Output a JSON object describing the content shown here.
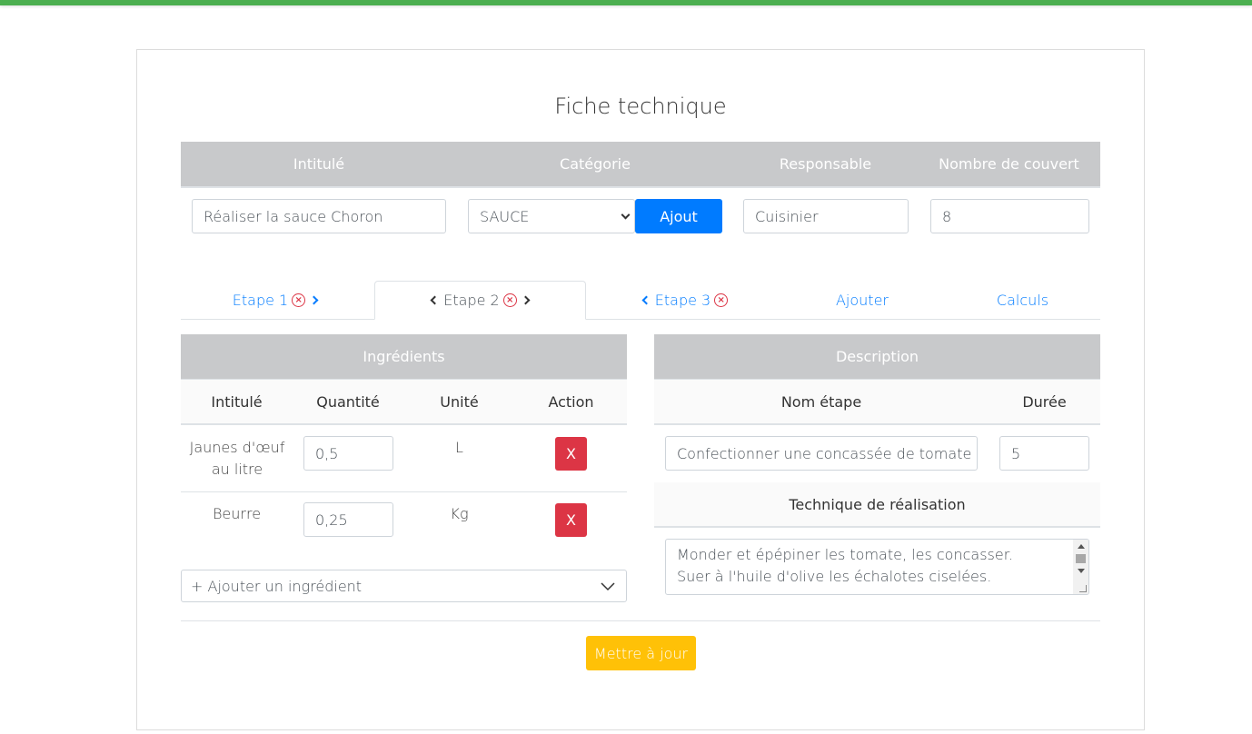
{
  "page": {
    "title": "Fiche technique"
  },
  "general": {
    "headers": {
      "intitule": "Intitulé",
      "categorie": "Catégorie",
      "responsable": "Responsable",
      "couverts": "Nombre de couvert"
    },
    "intitule_value": "Réaliser la sauce Choron",
    "categorie_value": "SAUCE",
    "ajout_label": "Ajout",
    "responsable_value": "Cuisinier",
    "couverts_value": "8"
  },
  "tabs": [
    {
      "label": "Etape 1"
    },
    {
      "label": "Etape 2"
    },
    {
      "label": "Etape 3"
    },
    {
      "label": "Ajouter"
    },
    {
      "label": "Calculs"
    }
  ],
  "ingredients": {
    "title": "Ingrédients",
    "columns": [
      "Intitulé",
      "Quantité",
      "Unité",
      "Action"
    ],
    "rows": [
      {
        "name": "Jaunes d'œuf au litre",
        "quantity": "0,5",
        "unit": "L",
        "action": "X"
      },
      {
        "name": "Beurre",
        "quantity": "0,25",
        "unit": "Kg",
        "action": "X"
      }
    ],
    "add_label": "+ Ajouter un ingrédient"
  },
  "description": {
    "title": "Description",
    "columns": [
      "Nom étape",
      "Durée"
    ],
    "nom_etape_value": "Confectionner une concassée de tomate",
    "duree_value": "5",
    "technique_title": "Technique de réalisation",
    "technique_line1": "Monder et épépiner les tomate, les concasser.",
    "technique_line2": "Suer à l'huile d'olive les échalotes ciselées."
  },
  "actions": {
    "update_label": "Mettre à jour"
  },
  "colors": {
    "accent_green": "#4caf50",
    "primary": "#007bff",
    "danger": "#dc3545",
    "warning": "#ffc107",
    "header_gray": "#c8c9cb"
  },
  "icons": {
    "tab_close": "x-circle-icon",
    "prev": "chevron-left-icon",
    "next": "chevron-right-icon",
    "dropdown": "chevron-down-icon"
  }
}
